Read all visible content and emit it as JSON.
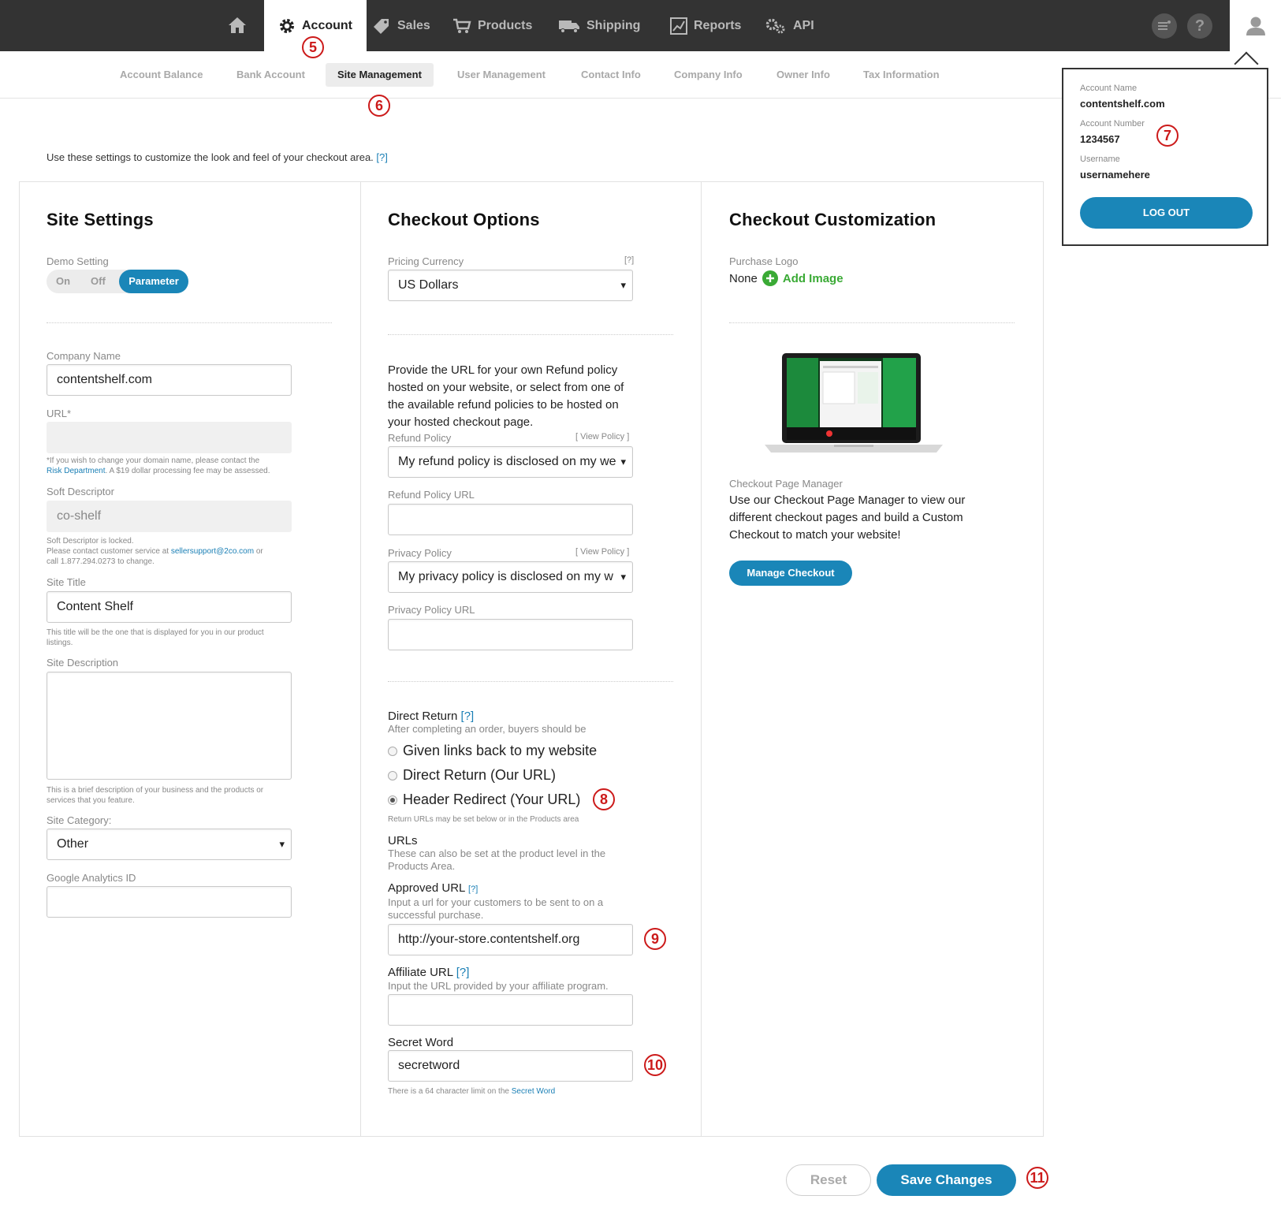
{
  "nav": {
    "items": [
      {
        "label": "Account",
        "icon": "gear-icon"
      },
      {
        "label": "Sales",
        "icon": "tag-icon"
      },
      {
        "label": "Products",
        "icon": "cart-icon"
      },
      {
        "label": "Shipping",
        "icon": "truck-icon"
      },
      {
        "label": "Reports",
        "icon": "chart-icon"
      },
      {
        "label": "API",
        "icon": "gears-icon"
      }
    ],
    "help": "?"
  },
  "subnav": {
    "items": [
      "Account Balance",
      "Bank Account",
      "Site Management",
      "User Management",
      "Contact Info",
      "Company Info",
      "Owner Info",
      "Tax Information"
    ]
  },
  "callouts": [
    "5",
    "6",
    "7",
    "8",
    "9",
    "10",
    "11"
  ],
  "intro": {
    "text": "Use these settings to customize the look and feel of your checkout area.",
    "help": "[?]"
  },
  "site_settings": {
    "title": "Site Settings",
    "demo_label": "Demo Setting",
    "toggle": {
      "on": "On",
      "off": "Off",
      "param": "Parameter",
      "selected": "Parameter"
    },
    "company_label": "Company Name",
    "company_value": "contentshelf.com",
    "url_label": "URL*",
    "url_note_1": "*If you wish to change your domain name, please contact the",
    "url_note_link": "Risk Department",
    "url_note_2": ". A $19 dollar processing fee may be assessed.",
    "soft_label": "Soft Descriptor",
    "soft_value": "co-shelf",
    "soft_note_1": "Soft Descriptor is locked.",
    "soft_note_2": "Please contact customer service at ",
    "soft_note_link": "sellersupport@2co.com",
    "soft_note_3": " or",
    "soft_note_4": "call 1.877.294.0273 to change.",
    "title_label": "Site Title",
    "title_value": "Content Shelf",
    "title_note": "This title will be the one that is displayed for you in our product listings.",
    "desc_label": "Site Description",
    "desc_note": "This is a brief description of your business and the products or services that you feature.",
    "category_label": "Site Category:",
    "category_value": "Other",
    "ga_label": "Google Analytics ID"
  },
  "checkout_options": {
    "title": "Checkout Options",
    "currency_label": "Pricing Currency",
    "currency_help": "[?]",
    "currency_value": "US Dollars",
    "refund_para": "Provide the URL for your own Refund policy hosted on your website, or select from one of the available refund policies to be hosted on your hosted checkout page.",
    "refund_label": "Refund Policy",
    "view_policy": "[ View Policy ]",
    "refund_value": "My refund policy is disclosed on my we",
    "refund_url_label": "Refund Policy URL",
    "privacy_label": "Privacy Policy",
    "privacy_value": "My privacy policy is disclosed on my w",
    "privacy_url_label": "Privacy Policy URL",
    "direct_label": "Direct Return",
    "direct_help": "[?]",
    "direct_sub": "After completing an order, buyers should be",
    "radios": [
      "Given links back to my website",
      "Direct Return (Our URL)",
      "Header Redirect (Your URL)"
    ],
    "radio_selected": "Header Redirect (Your URL)",
    "return_note": "Return URLs may be set below or in the Products area",
    "urls_label": "URLs",
    "urls_sub": "These can also be set at the product level in the Products Area.",
    "approved_label": "Approved URL",
    "approved_help": "[?]",
    "approved_sub": "Input a url for your customers to be sent to on a successful purchase.",
    "approved_value": "http://your-store.contentshelf.org",
    "affiliate_label": "Affiliate URL",
    "affiliate_help": "[?]",
    "affiliate_sub": "Input the URL provided by your affiliate program.",
    "secret_label": "Secret Word",
    "secret_value": "secretword",
    "secret_note": "There is a 64 character limit on the ",
    "secret_note_link": "Secret Word"
  },
  "customization": {
    "title": "Checkout Customization",
    "logo_label": "Purchase Logo",
    "logo_value": "None",
    "add_image": "Add Image",
    "manager_label": "Checkout Page Manager",
    "manager_text": "Use our Checkout Page Manager to view our different checkout pages and build a Custom Checkout to match your website!",
    "manage_button": "Manage Checkout"
  },
  "footer": {
    "reset": "Reset",
    "save": "Save Changes"
  },
  "popover": {
    "account_name_label": "Account Name",
    "account_name": "contentshelf.com",
    "account_number_label": "Account Number",
    "account_number": "1234567",
    "username_label": "Username",
    "username": "usernamehere",
    "logout": "LOG OUT"
  },
  "colors": {
    "nav_bg": "#333333",
    "accent": "#1a86b8",
    "callout": "#cc1a1a",
    "add_green": "#3aaa35"
  }
}
